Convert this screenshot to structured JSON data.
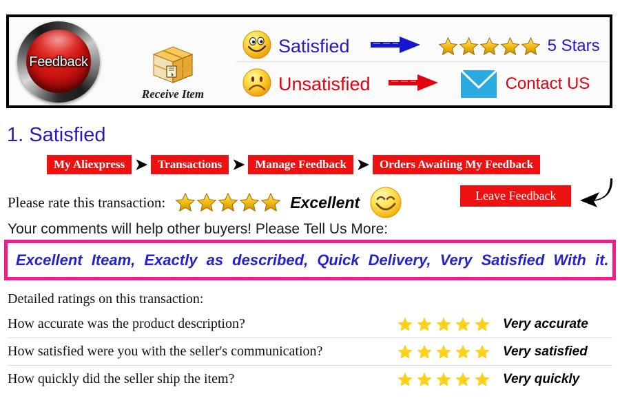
{
  "banner": {
    "feedback_button_label": "Feedback",
    "package_label": "Receive Item",
    "satisfied_label": "Satisfied",
    "unsatisfied_label": "Unsatisfied",
    "five_stars_label": "5 Stars",
    "contact_label": "Contact US",
    "colors": {
      "satisfied_text": "#2916c4",
      "unsatisfied_text": "#e3000f",
      "satisfied_arrow": "#1616cc",
      "unsatisfied_arrow": "#e3000f",
      "envelope": "#29abe2",
      "star_gold": "#f6b70b",
      "feedback_red": "#cc1410"
    }
  },
  "section": {
    "heading": "1. Satisfied"
  },
  "breadcrumb": {
    "separator": "➤",
    "items": [
      {
        "label": "My Aliexpress"
      },
      {
        "label": "Transactions"
      },
      {
        "label": "Manage Feedback"
      },
      {
        "label": "Orders Awaiting My Feedback"
      }
    ]
  },
  "rate": {
    "label": "Please rate this transaction:",
    "stars": 5,
    "verdict": "Excellent",
    "leave_feedback_label": "Leave Feedback"
  },
  "comment": {
    "prompt": "Your comments will help other buyers! Please Tell Us More:",
    "text": "Excellent Iteam, Exactly as described, Quick Delivery, Very Satisfied With it.",
    "border_color": "#ee1e8c",
    "text_color": "#2222cc"
  },
  "detailed": {
    "title": "Detailed ratings on this transaction:",
    "rows": [
      {
        "question": "How accurate was the product description?",
        "stars": 5,
        "verdict": "Very accurate"
      },
      {
        "question": "How satisfied were you with the seller's communication?",
        "stars": 5,
        "verdict": "Very satisfied"
      },
      {
        "question": "How quickly did the seller ship the item?",
        "stars": 5,
        "verdict": "Very quickly"
      }
    ],
    "star_color": "#ffd11a"
  }
}
